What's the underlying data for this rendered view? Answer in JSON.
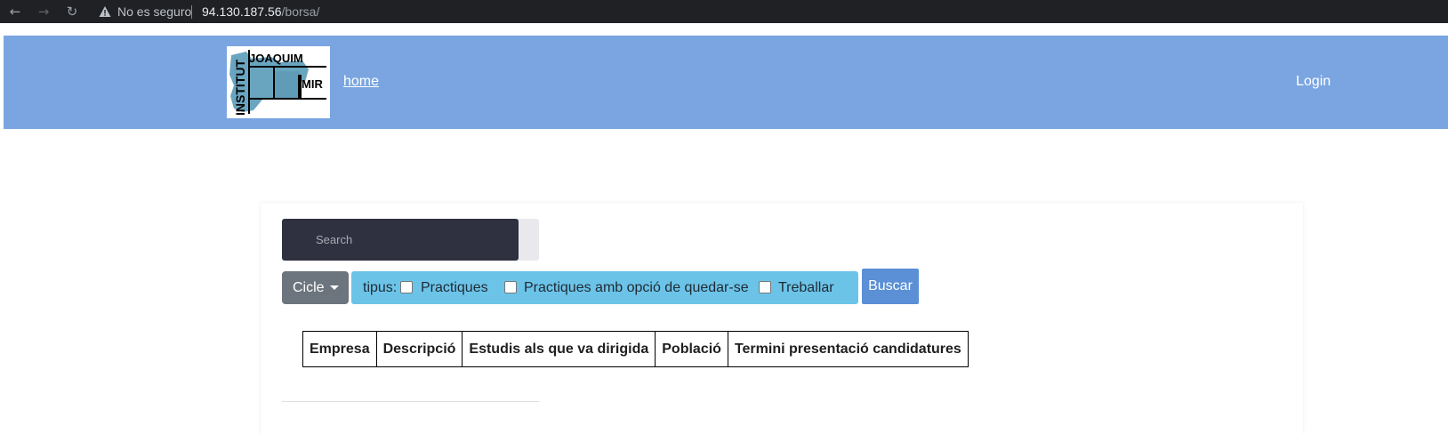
{
  "browser": {
    "security_text": "No es seguro",
    "url_host": "94.130.187.56",
    "url_path": "/borsa/"
  },
  "header": {
    "logo_text": [
      "INSTITUT",
      "JOAQUIM",
      "MIR"
    ],
    "home_link": "home",
    "login_link": "Login",
    "background_color": "#7aa5e1"
  },
  "search": {
    "placeholder": "Search"
  },
  "filters": {
    "cicle_label": "Cicle",
    "tipus_label": "tipus:",
    "options": [
      "Practiques",
      "Practiques amb opció de quedar-se",
      "Treballar"
    ],
    "buscar_label": "Buscar"
  },
  "table": {
    "headers": [
      "Empresa",
      "Descripció",
      "Estudis als que va dirigida",
      "Població",
      "Termini presentació candidatures"
    ]
  },
  "icons": {
    "back": "arrow-left-icon",
    "forward": "arrow-right-icon",
    "reload": "reload-icon",
    "warning": "warning-triangle-icon",
    "dropdown": "caret-down-icon"
  }
}
